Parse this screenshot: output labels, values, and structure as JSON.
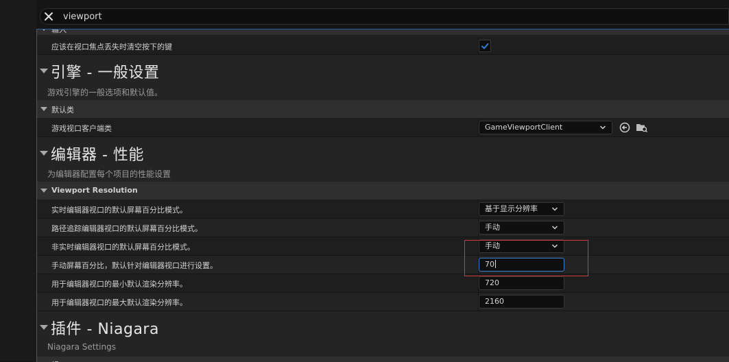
{
  "search": {
    "value": "viewport"
  },
  "panel": {
    "top_clipped_header": "输入",
    "row_focus_lost": {
      "label": "应该在视口焦点丢失时清空按下的键",
      "checked": true
    },
    "section_engine": {
      "title": "引擎 - 一般设置",
      "subtitle": "游戏引擎的一般选项和默认值。",
      "category": "默认类",
      "row_client": {
        "label": "游戏视口客户端类",
        "value": "GameViewportClient"
      }
    },
    "section_editor_perf": {
      "title": "编辑器 - 性能",
      "subtitle": "为编辑器配置每个项目的性能设置",
      "category": "Viewport Resolution",
      "rows": [
        {
          "label": "实时编辑器视口的默认屏幕百分比模式。",
          "value": "基于显示分辨率"
        },
        {
          "label": "路径追踪编辑器视口的默认屏幕百分比模式。",
          "value": "手动"
        },
        {
          "label": "非实时编辑器视口的默认屏幕百分比模式。",
          "value": "手动"
        },
        {
          "label": "手动屏幕百分比，默认针对编辑器视口进行设置。",
          "value": "70"
        },
        {
          "label": "用于编辑器视口的最小默认渲染分辨率。",
          "value": "720"
        },
        {
          "label": "用于编辑器视口的最大默认渲染分辨率。",
          "value": "2160"
        }
      ]
    },
    "section_niagara": {
      "title": "插件 - Niagara",
      "subtitle": "Niagara Settings",
      "category_clipped": "视口"
    }
  },
  "colors": {
    "accent_blue": "#3d7fcf",
    "highlight_red": "#d33a3a",
    "checkbox_check": "#2f7fd6"
  }
}
